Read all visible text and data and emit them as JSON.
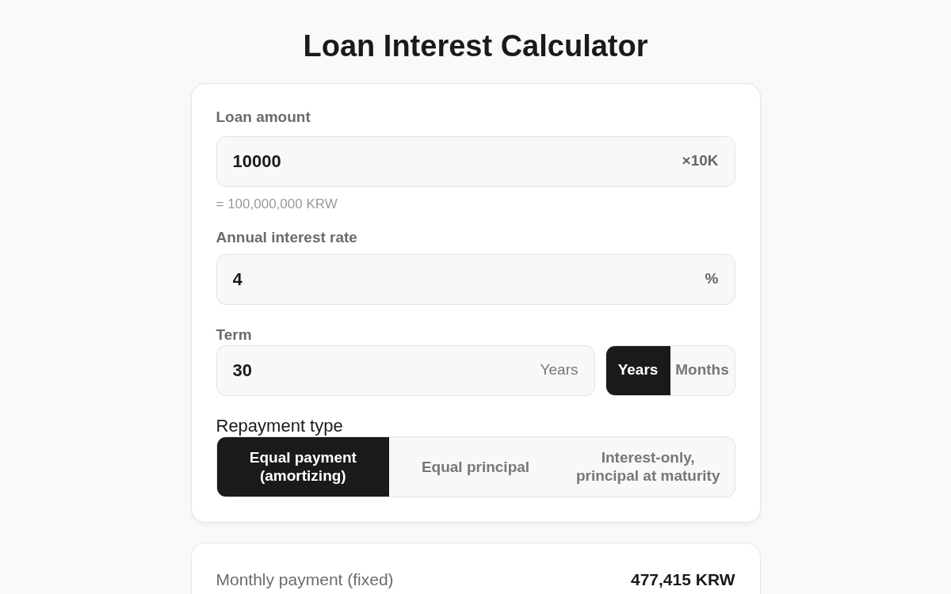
{
  "title": "Loan Interest Calculator",
  "fields": [
    {
      "label": "Loan amount",
      "value": "10000",
      "suffix": "×10K",
      "suffix_bold": true,
      "hint": "= 100,000,000 KRW"
    },
    {
      "label": "Annual interest rate",
      "value": "4",
      "suffix": "%",
      "suffix_bold": true
    }
  ],
  "term": {
    "label": "Term",
    "value": "30",
    "suffix": "Years",
    "units": [
      {
        "label": "Years",
        "selected": true
      },
      {
        "label": "Months",
        "selected": false
      }
    ]
  },
  "repayment": {
    "label": "Repayment type",
    "options": [
      {
        "label": "Equal payment\n(amortizing)",
        "selected": true
      },
      {
        "label": "Equal principal",
        "selected": false
      },
      {
        "label": "Interest-only,\nprincipal at maturity",
        "selected": false
      }
    ]
  },
  "results": [
    {
      "label": "Monthly payment (fixed)",
      "value": "477,415 KRW"
    }
  ]
}
